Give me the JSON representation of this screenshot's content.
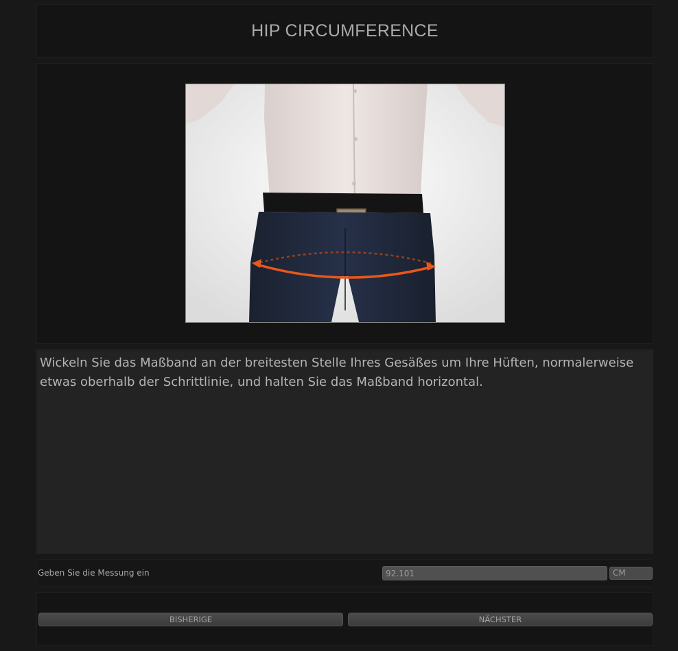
{
  "page": {
    "title": "HIP CIRCUMFERENCE"
  },
  "illustration": {
    "subject": "person-torso-with-hip-measuring-tape",
    "accent_color": "#e8571a"
  },
  "instructions": {
    "text": "Wickeln Sie das Maßband an der breitesten Stelle Ihres Gesäßes um Ihre Hüften, normalerweise etwas oberhalb der Schrittlinie, und halten Sie das Maßband horizontal."
  },
  "measurement": {
    "label": "Geben Sie die Messung ein",
    "value": "92.101",
    "unit": "CM"
  },
  "navigation": {
    "previous_label": "BISHERIGE",
    "next_label": "NÄCHSTER"
  }
}
